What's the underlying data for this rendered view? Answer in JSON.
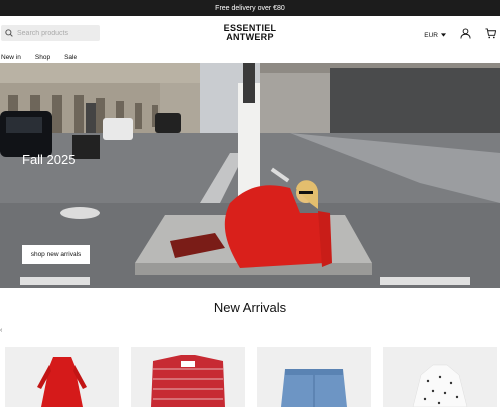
{
  "announcement": "Free delivery over €80",
  "search": {
    "placeholder": "Search products"
  },
  "logo": {
    "line1": "ESSENTIEL",
    "line2": "ANTWERP"
  },
  "currency": {
    "label": "EUR"
  },
  "nav": {
    "items": [
      "New in",
      "Shop",
      "Sale"
    ]
  },
  "hero": {
    "title": "Fall 2025",
    "button": "shop new arrivals"
  },
  "new_arrivals": {
    "title": "New Arrivals"
  },
  "colors": {
    "accent": "#d9201b",
    "dark": "#1c1c1c"
  },
  "products": [
    {
      "name": "red-dress"
    },
    {
      "name": "red-tweed-jacket"
    },
    {
      "name": "denim-shorts"
    },
    {
      "name": "polka-dot-blouse"
    }
  ]
}
